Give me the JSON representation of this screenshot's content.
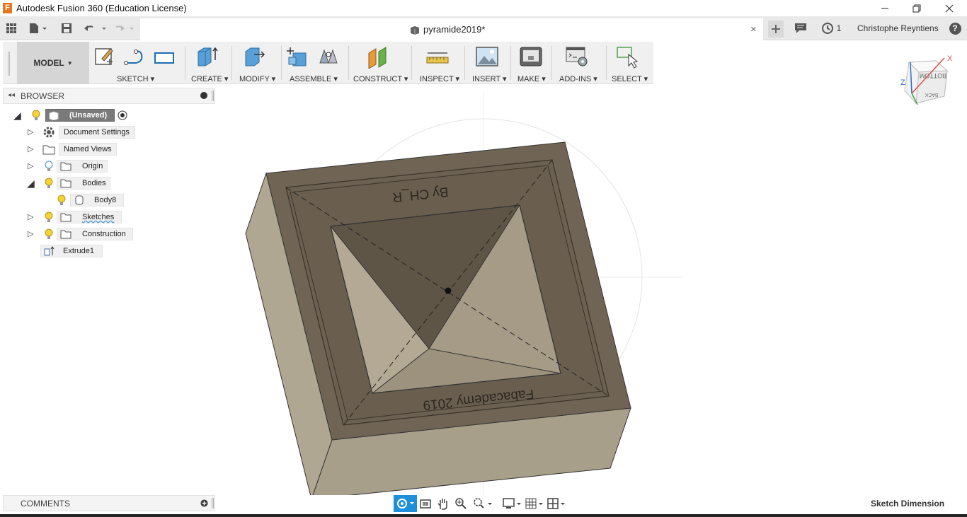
{
  "window": {
    "title": "Autodesk Fusion 360 (Education License)",
    "logo_letter": "F"
  },
  "tabbar": {
    "document_name": "pyramide2019*",
    "job_count": "1",
    "user_name": "Christophe Reyntiens",
    "help_label": "?"
  },
  "toolbar": {
    "workspace": "MODEL",
    "groups": [
      "SKETCH",
      "CREATE",
      "MODIFY",
      "ASSEMBLE",
      "CONSTRUCT",
      "INSPECT",
      "INSERT",
      "MAKE",
      "ADD-INS",
      "SELECT"
    ]
  },
  "browser": {
    "header": "BROWSER",
    "items": [
      {
        "label": "(Unsaved)"
      },
      {
        "label": "Document Settings"
      },
      {
        "label": "Named Views"
      },
      {
        "label": "Origin"
      },
      {
        "label": "Bodies"
      },
      {
        "label": "Body8"
      },
      {
        "label": "Sketches"
      },
      {
        "label": "Construction"
      },
      {
        "label": "Extrude1"
      }
    ]
  },
  "comments": {
    "header": "COMMENTS"
  },
  "viewcube": {
    "face_top": "BOTTOM",
    "face_side": "BACK",
    "axis_x": "X",
    "axis_z": "Z"
  },
  "model": {
    "engraving_top": "By CH_R",
    "engraving_bottom": "Fabacademy 2019"
  },
  "status": {
    "label": "Sketch Dimension"
  },
  "colors": {
    "model_top": "#706554",
    "model_side_left": "#b0a793",
    "model_side_front": "#a89f8b",
    "pyramid_light": "#a69b87",
    "pyramid_dark": "#5f5546",
    "accent_blue": "#0696d7"
  }
}
